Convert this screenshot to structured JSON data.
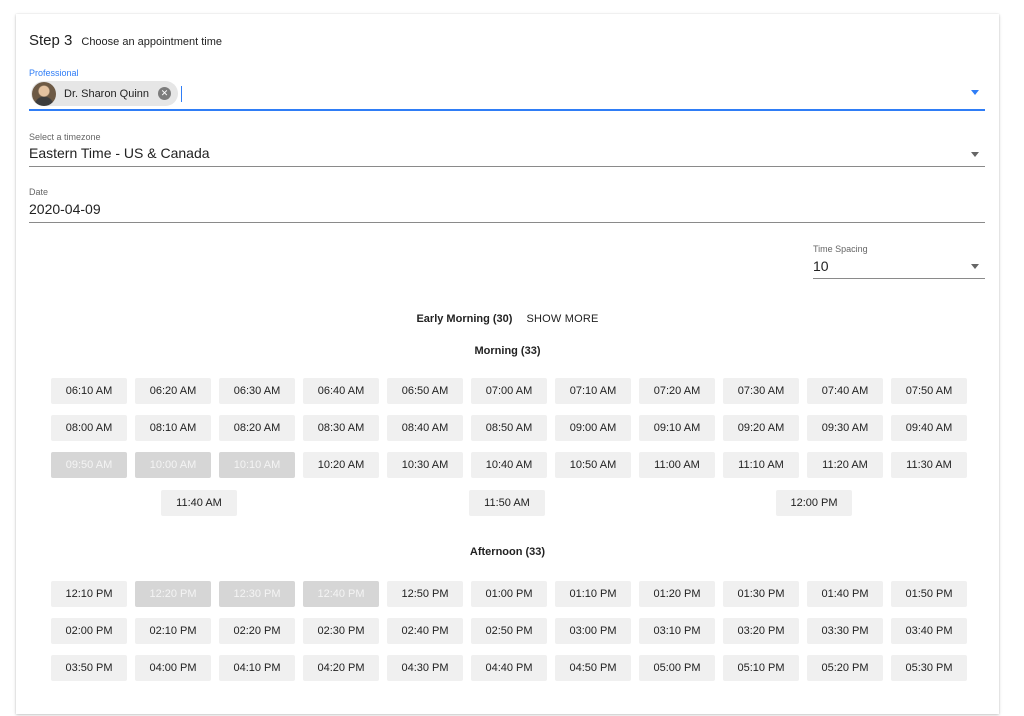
{
  "step": {
    "number": "Step 3",
    "title": "Choose an appointment time"
  },
  "professional": {
    "label": "Professional",
    "chip_name": "Dr. Sharon Quinn",
    "chip_close_icon": "close-circle-icon",
    "dropdown_icon": "caret-down-icon"
  },
  "timezone": {
    "label": "Select a timezone",
    "value": "Eastern Time - US & Canada",
    "dropdown_icon": "caret-down-icon"
  },
  "date": {
    "label": "Date",
    "value": "2020-04-09"
  },
  "time_spacing": {
    "label": "Time Spacing",
    "value": "10",
    "dropdown_icon": "caret-down-icon"
  },
  "colors": {
    "accent": "#2f7df6",
    "slot_bg": "#f0f0f0",
    "slot_disabled_bg": "#d6d6d6"
  },
  "sections": {
    "early_morning": {
      "title": "Early Morning (30)",
      "show_more": "SHOW MORE"
    },
    "morning": {
      "title": "Morning (33)",
      "slots": [
        {
          "label": "06:10 AM",
          "disabled": false
        },
        {
          "label": "06:20 AM",
          "disabled": false
        },
        {
          "label": "06:30 AM",
          "disabled": false
        },
        {
          "label": "06:40 AM",
          "disabled": false
        },
        {
          "label": "06:50 AM",
          "disabled": false
        },
        {
          "label": "07:00 AM",
          "disabled": false
        },
        {
          "label": "07:10 AM",
          "disabled": false
        },
        {
          "label": "07:20 AM",
          "disabled": false
        },
        {
          "label": "07:30 AM",
          "disabled": false
        },
        {
          "label": "07:40 AM",
          "disabled": false
        },
        {
          "label": "07:50 AM",
          "disabled": false
        },
        {
          "label": "08:00 AM",
          "disabled": false
        },
        {
          "label": "08:10 AM",
          "disabled": false
        },
        {
          "label": "08:20 AM",
          "disabled": false
        },
        {
          "label": "08:30 AM",
          "disabled": false
        },
        {
          "label": "08:40 AM",
          "disabled": false
        },
        {
          "label": "08:50 AM",
          "disabled": false
        },
        {
          "label": "09:00 AM",
          "disabled": false
        },
        {
          "label": "09:10 AM",
          "disabled": false
        },
        {
          "label": "09:20 AM",
          "disabled": false
        },
        {
          "label": "09:30 AM",
          "disabled": false
        },
        {
          "label": "09:40 AM",
          "disabled": false
        },
        {
          "label": "09:50 AM",
          "disabled": true
        },
        {
          "label": "10:00 AM",
          "disabled": true
        },
        {
          "label": "10:10 AM",
          "disabled": true
        },
        {
          "label": "10:20 AM",
          "disabled": false
        },
        {
          "label": "10:30 AM",
          "disabled": false
        },
        {
          "label": "10:40 AM",
          "disabled": false
        },
        {
          "label": "10:50 AM",
          "disabled": false
        },
        {
          "label": "11:00 AM",
          "disabled": false
        },
        {
          "label": "11:10 AM",
          "disabled": false
        },
        {
          "label": "11:20 AM",
          "disabled": false
        },
        {
          "label": "11:30 AM",
          "disabled": false
        }
      ],
      "extra_slots": [
        "11:40 AM",
        "11:50 AM",
        "12:00 PM"
      ]
    },
    "afternoon": {
      "title": "Afternoon (33)",
      "slots": [
        {
          "label": "12:10 PM",
          "disabled": false
        },
        {
          "label": "12:20 PM",
          "disabled": true
        },
        {
          "label": "12:30 PM",
          "disabled": true
        },
        {
          "label": "12:40 PM",
          "disabled": true
        },
        {
          "label": "12:50 PM",
          "disabled": false
        },
        {
          "label": "01:00 PM",
          "disabled": false
        },
        {
          "label": "01:10 PM",
          "disabled": false
        },
        {
          "label": "01:20 PM",
          "disabled": false
        },
        {
          "label": "01:30 PM",
          "disabled": false
        },
        {
          "label": "01:40 PM",
          "disabled": false
        },
        {
          "label": "01:50 PM",
          "disabled": false
        },
        {
          "label": "02:00 PM",
          "disabled": false
        },
        {
          "label": "02:10 PM",
          "disabled": false
        },
        {
          "label": "02:20 PM",
          "disabled": false
        },
        {
          "label": "02:30 PM",
          "disabled": false
        },
        {
          "label": "02:40 PM",
          "disabled": false
        },
        {
          "label": "02:50 PM",
          "disabled": false
        },
        {
          "label": "03:00 PM",
          "disabled": false
        },
        {
          "label": "03:10 PM",
          "disabled": false
        },
        {
          "label": "03:20 PM",
          "disabled": false
        },
        {
          "label": "03:30 PM",
          "disabled": false
        },
        {
          "label": "03:40 PM",
          "disabled": false
        },
        {
          "label": "03:50 PM",
          "disabled": false
        },
        {
          "label": "04:00 PM",
          "disabled": false
        },
        {
          "label": "04:10 PM",
          "disabled": false
        },
        {
          "label": "04:20 PM",
          "disabled": false
        },
        {
          "label": "04:30 PM",
          "disabled": false
        },
        {
          "label": "04:40 PM",
          "disabled": false
        },
        {
          "label": "04:50 PM",
          "disabled": false
        },
        {
          "label": "05:00 PM",
          "disabled": false
        },
        {
          "label": "05:10 PM",
          "disabled": false
        },
        {
          "label": "05:20 PM",
          "disabled": false
        },
        {
          "label": "05:30 PM",
          "disabled": false
        }
      ]
    }
  }
}
